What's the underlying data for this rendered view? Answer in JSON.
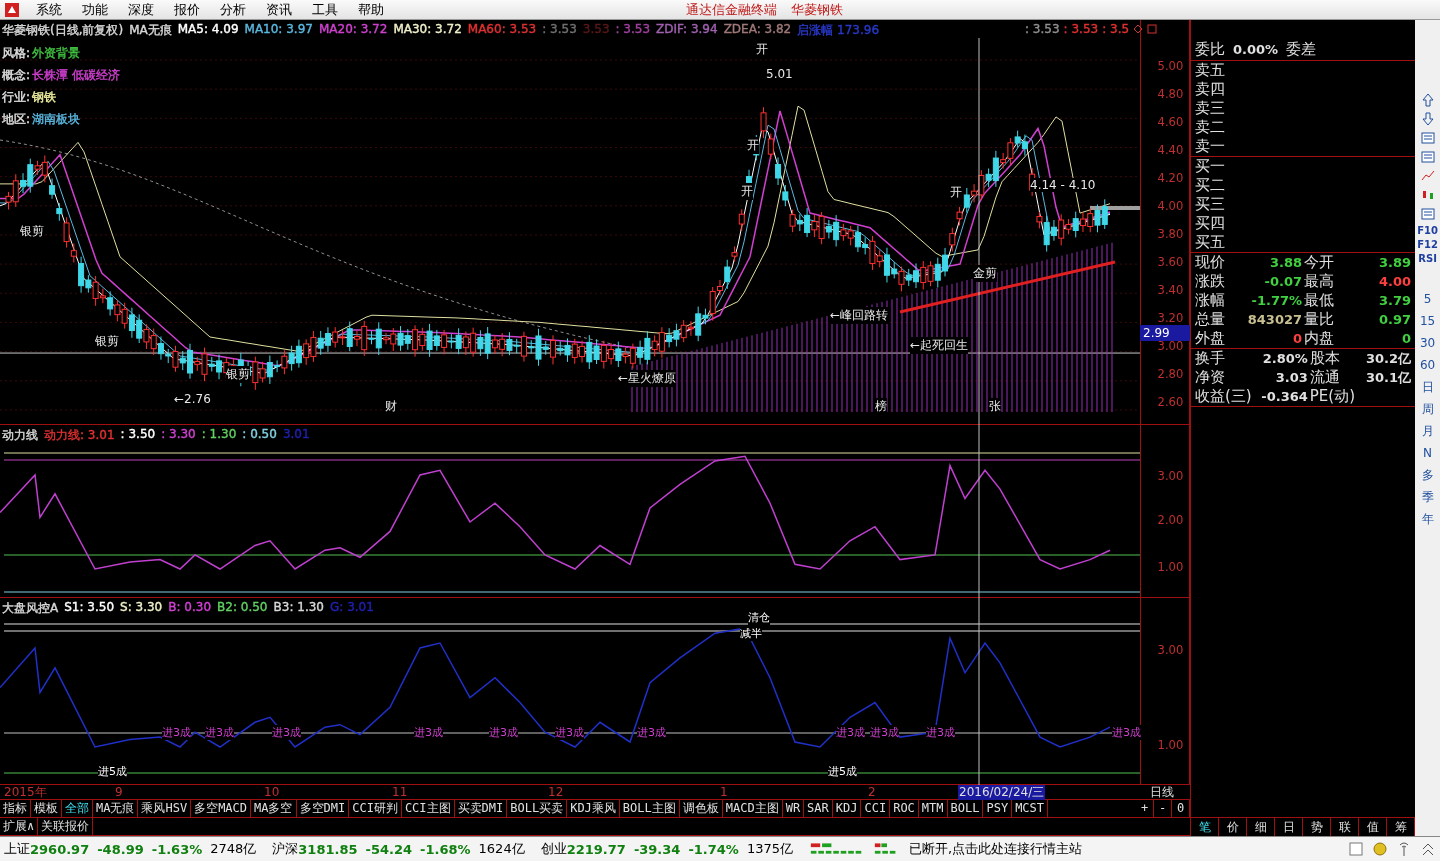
{
  "menu": [
    "系统",
    "功能",
    "深度",
    "报价",
    "分析",
    "资讯",
    "工具",
    "帮助"
  ],
  "title_parts": [
    "通达信金融终端",
    "华菱钢铁"
  ],
  "legend": [
    {
      "text": "华菱钢铁(日线,前复权)",
      "color": "#d8d8d8"
    },
    {
      "text": "MA无痕",
      "color": "#d8d8d8"
    },
    {
      "text": "MA5: 4.09",
      "color": "#ffffff"
    },
    {
      "text": "MA10: 3.97",
      "color": "#5ab8e0"
    },
    {
      "text": "MA20: 3.72",
      "color": "#d040d0"
    },
    {
      "text": "MA30: 3.72",
      "color": "#f0f0c8"
    },
    {
      "text": "MA60: 3.53",
      "color": "#e03030"
    },
    {
      "text": ": 3.53",
      "color": "#707070"
    },
    {
      "text": "3.53",
      "color": "#5a1818"
    },
    {
      "text": ": 3.53",
      "color": "#a040a0"
    },
    {
      "text": "ZDIF: 3.94",
      "color": "#a060b0"
    },
    {
      "text": "ZDEA: 3.82",
      "color": "#a07878"
    },
    {
      "text": "启涨幅 173.96",
      "color": "#2838c8"
    }
  ],
  "legend_right": [
    {
      "text": ": 3.53",
      "color": "#909090"
    },
    {
      "text": ": 3.53",
      "color": "#e03030"
    },
    {
      "text": ": 3.5",
      "color": "#e03030"
    }
  ],
  "info_rows": [
    {
      "label": "风格:",
      "value": "外资背景",
      "color": "#40c040"
    },
    {
      "label": "概念:",
      "value": "长株潭 低碳经济",
      "color": "#d040d0"
    },
    {
      "label": "行业:",
      "value": "钢铁",
      "color": "#f0f0a0"
    },
    {
      "label": "地区:",
      "value": "湖南板块",
      "color": "#5ab8e0"
    }
  ],
  "price_axis": [
    "5.00",
    "4.80",
    "4.60",
    "4.40",
    "4.20",
    "4.00",
    "3.80",
    "3.60",
    "3.40",
    "3.20",
    "3.00",
    "2.80",
    "2.60"
  ],
  "price_tag": "2.99",
  "annotations": [
    {
      "text": "5.01"
    },
    {
      "text": "开"
    },
    {
      "text": "开"
    },
    {
      "text": "开"
    },
    {
      "text": "开"
    },
    {
      "text": "银剪"
    },
    {
      "text": "银剪"
    },
    {
      "text": "银剪"
    },
    {
      "text": "金剪"
    },
    {
      "text": "←2.76"
    },
    {
      "text": "←星火燎原"
    },
    {
      "text": "←峰回路转"
    },
    {
      "text": "←起死回生"
    },
    {
      "text": "4.14 - 4.10"
    },
    {
      "text": "财"
    },
    {
      "text": "榜"
    },
    {
      "text": "张"
    }
  ],
  "ind1": {
    "legend": [
      {
        "text": "动力线",
        "color": "#d8d8d8"
      },
      {
        "text": "动力线: 3.01",
        "color": "#e03030"
      },
      {
        "text": ": 3.50",
        "color": "#ffffff"
      },
      {
        "text": ": 3.30",
        "color": "#d040d0"
      },
      {
        "text": ": 1.30",
        "color": "#60d060"
      },
      {
        "text": ": 0.50",
        "color": "#80d0e0"
      },
      {
        "text": "3.01",
        "color": "#2020b0"
      }
    ],
    "axis": [
      "3.00",
      "2.00",
      "1.00"
    ]
  },
  "ind2": {
    "legend": [
      {
        "text": "大盘风控A",
        "color": "#d8d8d8"
      },
      {
        "text": "S1: 3.50",
        "color": "#ffffff"
      },
      {
        "text": "S: 3.30",
        "color": "#f0f0c8"
      },
      {
        "text": "B: 0.30",
        "color": "#d040d0"
      },
      {
        "text": "B2: 0.50",
        "color": "#60d060"
      },
      {
        "text": "B3: 1.30",
        "color": "#d8d8d8"
      },
      {
        "text": "G: 3.01",
        "color": "#2020b0"
      }
    ],
    "axis": [
      "3.00",
      "1.00"
    ],
    "signals": [
      {
        "text": "清仓"
      },
      {
        "text": "减半"
      },
      {
        "text": "进3成"
      },
      {
        "text": "进3成"
      },
      {
        "text": "进3成"
      },
      {
        "text": "进3成"
      },
      {
        "text": "进3成"
      },
      {
        "text": "进3成"
      },
      {
        "text": "进3成"
      },
      {
        "text": "进3成"
      },
      {
        "text": "进3成"
      },
      {
        "text": "进3成"
      },
      {
        "text": "进3成"
      },
      {
        "text": "进5成"
      },
      {
        "text": "进5成"
      }
    ]
  },
  "time_axis": [
    "2015年",
    "9",
    "10",
    "11",
    "12",
    "1",
    "2"
  ],
  "cursor_date": "2016/02/24/三",
  "period": "日线",
  "tabs": [
    {
      "label": "指标",
      "selected": false
    },
    {
      "label": "模板",
      "selected": false
    },
    {
      "label": "全部",
      "selected": true
    },
    {
      "label": "MA无痕",
      "selected": false
    },
    {
      "label": "乘风HSV",
      "selected": false
    },
    {
      "label": "多空MACD",
      "selected": false
    },
    {
      "label": "MA多空",
      "selected": false
    },
    {
      "label": "多空DMI",
      "selected": false
    },
    {
      "label": "CCI研判",
      "selected": false
    },
    {
      "label": "CCI主图",
      "selected": false
    },
    {
      "label": "买卖DMI",
      "selected": false
    },
    {
      "label": "BOLL买卖",
      "selected": false
    },
    {
      "label": "KDJ乘风",
      "selected": false
    },
    {
      "label": "BOLL主图",
      "selected": false
    },
    {
      "label": "调色板",
      "selected": false
    },
    {
      "label": "MACD主图",
      "selected": false
    },
    {
      "label": "WR",
      "selected": false
    },
    {
      "label": "SAR",
      "selected": false
    },
    {
      "label": "KDJ",
      "selected": false
    },
    {
      "label": "CCI",
      "selected": false
    },
    {
      "label": "ROC",
      "selected": false
    },
    {
      "label": "MTM",
      "selected": false
    },
    {
      "label": "BOLL",
      "selected": false
    },
    {
      "label": "PSY",
      "selected": false
    },
    {
      "label": "MCST",
      "selected": false
    }
  ],
  "tab_controls": [
    "+",
    "-",
    "0"
  ],
  "extra_tabs": [
    "扩展∧",
    "关联报价"
  ],
  "quote": {
    "ratio_label": "委比",
    "ratio_value": "0.00%",
    "diff_label": "委差",
    "asks": [
      "卖五",
      "卖四",
      "卖三",
      "卖二",
      "卖一"
    ],
    "bids": [
      "买一",
      "买二",
      "买三",
      "买四",
      "买五"
    ],
    "stats": [
      {
        "label": "现价",
        "value": "3.88",
        "color": "#40d040"
      },
      {
        "label": "今开",
        "value": "3.89",
        "color": "#40d040"
      },
      {
        "label": "涨跌",
        "value": "-0.07",
        "color": "#40d040"
      },
      {
        "label": "最高",
        "value": "4.00",
        "color": "#ff4040"
      },
      {
        "label": "涨幅",
        "value": "-1.77%",
        "color": "#40d040"
      },
      {
        "label": "最低",
        "value": "3.79",
        "color": "#40d040"
      },
      {
        "label": "总量",
        "value": "843027",
        "color": "#c8c090"
      },
      {
        "label": "量比",
        "value": "0.97",
        "color": "#40d040"
      },
      {
        "label": "外盘",
        "value": "0",
        "color": "#ff4040"
      },
      {
        "label": "内盘",
        "value": "0",
        "color": "#40d040"
      }
    ],
    "stats2": [
      {
        "label": "换手",
        "value": "2.80%"
      },
      {
        "label": "股本",
        "value": "30.2亿"
      },
      {
        "label": "净资",
        "value": "3.03"
      },
      {
        "label": "流通",
        "value": "30.1亿"
      },
      {
        "label": "收益(三)",
        "value": "-0.364"
      },
      {
        "label": "PE(动)"
      }
    ]
  },
  "side_tabs": [
    {
      "label": "笔",
      "selected": true
    },
    {
      "label": "价",
      "selected": false
    },
    {
      "label": "细",
      "selected": false
    },
    {
      "label": "日",
      "selected": false
    },
    {
      "label": "势",
      "selected": false
    },
    {
      "label": "联",
      "selected": false
    },
    {
      "label": "值",
      "selected": false
    },
    {
      "label": "筹",
      "selected": false
    }
  ],
  "toolbar_labels": [
    "F10",
    "F12",
    "RSI"
  ],
  "periods": [
    "5",
    "15",
    "30",
    "60",
    "日",
    "周",
    "月",
    "N",
    "多",
    "季",
    "年"
  ],
  "indices": [
    {
      "name": "上证",
      "value": "2960.97",
      "change": "-48.99",
      "pct": "-1.63%",
      "amount": "2748亿"
    },
    {
      "name": "沪深",
      "value": "3181.85",
      "change": "-54.24",
      "pct": "-1.68%",
      "amount": "1624亿"
    },
    {
      "name": "创业",
      "value": "2219.77",
      "change": "-39.34",
      "pct": "-1.74%",
      "amount": "1375亿"
    }
  ],
  "connection": "已断开,点击此处连接行情主站"
}
